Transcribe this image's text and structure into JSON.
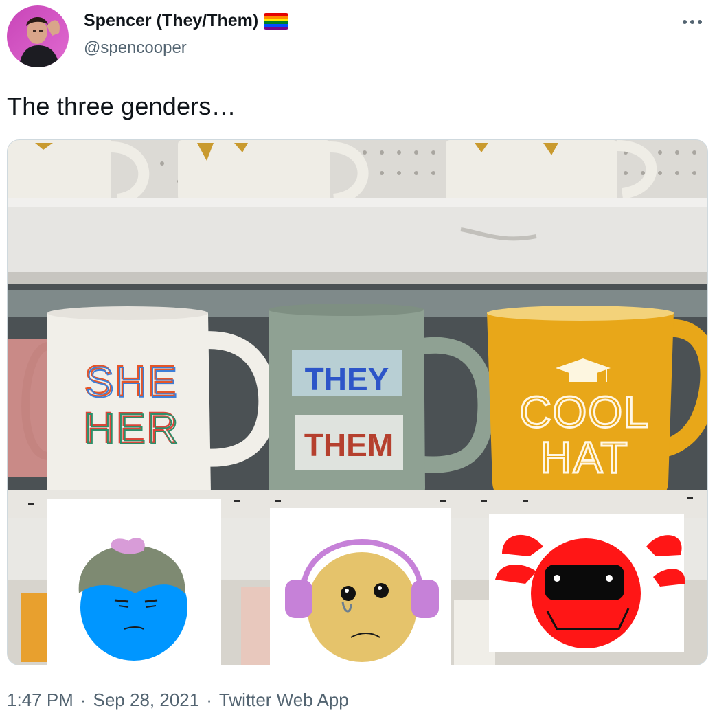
{
  "user": {
    "display_name": "Spencer (They/Them)",
    "handle": "@spencooper",
    "flag_icon": "rainbow-flag-icon"
  },
  "tweet": {
    "text": "The three genders…"
  },
  "media": {
    "mugs": [
      {
        "line1": "SHE",
        "line2": "HER"
      },
      {
        "line1": "THEY",
        "line2": "THEM"
      },
      {
        "line1": "COOL",
        "line2": "HAT"
      }
    ],
    "colors": {
      "she_mug": "#f1efe9",
      "they_mug": "#8fa193",
      "hat_mug": "#e8a719",
      "blue_face": "#0096ff",
      "yellow_face": "#e5c36b",
      "red_face": "#ff1616"
    }
  },
  "footer": {
    "time": "1:47 PM",
    "sep1": "·",
    "date": "Sep 28, 2021",
    "sep2": "·",
    "source": "Twitter Web App"
  }
}
